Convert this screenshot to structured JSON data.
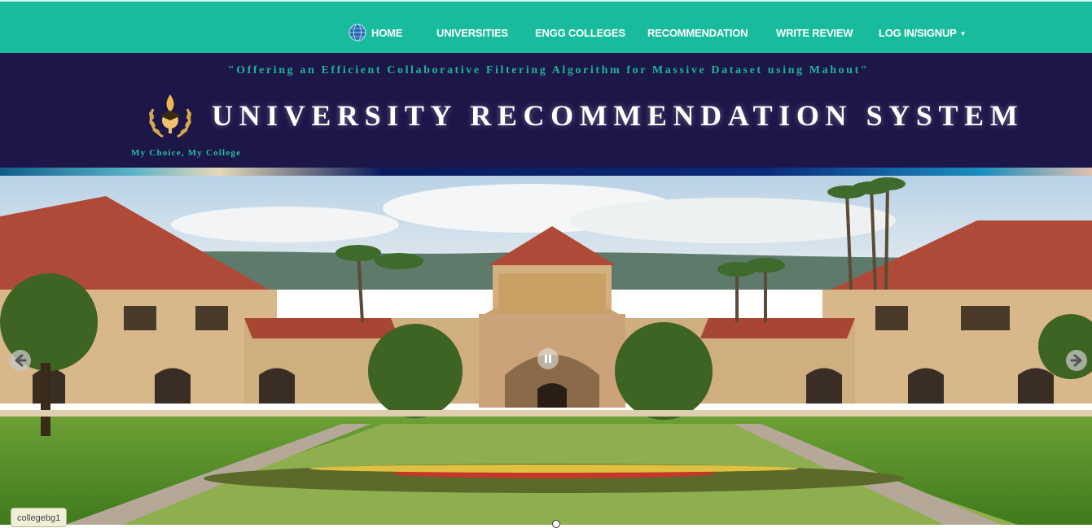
{
  "nav": {
    "items": [
      {
        "label": "HOME",
        "icon": "globe-icon"
      },
      {
        "label": "UNIVERSITIES"
      },
      {
        "label": "ENGG COLLEGES"
      },
      {
        "label": "RECOMMENDATION"
      },
      {
        "label": "WRITE REVIEW"
      },
      {
        "label": "LOG IN/SIGNUP",
        "dropdown": true
      }
    ]
  },
  "banner": {
    "tagline": "\"Offering an Efficient Collaborative Filtering Algorithm for Massive Dataset using Mahout\"",
    "title": "UNIVERSITY RECOMMENDATION SYSTEM",
    "motto": "My Choice, My College"
  },
  "slider": {
    "caption": "collegebg1",
    "prev_icon": "arrow-left-icon",
    "next_icon": "arrow-right-icon",
    "pause_icon": "pause-icon"
  },
  "colors": {
    "navbar": "#18bc9c",
    "banner": "#1c1649",
    "tagline": "#1fb59a"
  }
}
